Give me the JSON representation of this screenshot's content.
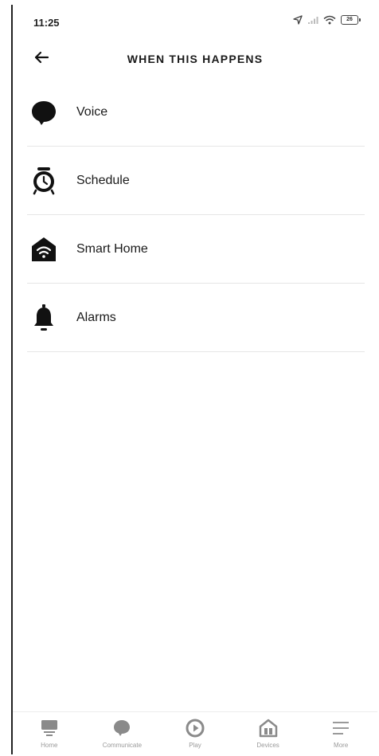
{
  "status_bar": {
    "time": "11:25",
    "battery": "26",
    "icons": [
      "location-arrow-icon",
      "signal-icon",
      "wifi-icon",
      "battery-icon"
    ]
  },
  "header": {
    "title": "WHEN THIS HAPPENS",
    "back_icon": "arrow-left-icon"
  },
  "triggers": [
    {
      "label": "Voice",
      "icon": "speech-bubble-icon"
    },
    {
      "label": "Schedule",
      "icon": "alarm-clock-icon"
    },
    {
      "label": "Smart Home",
      "icon": "smart-home-icon"
    },
    {
      "label": "Alarms",
      "icon": "bell-icon"
    }
  ],
  "bottom_nav": [
    {
      "label": "Home",
      "icon": "home-icon"
    },
    {
      "label": "Communicate",
      "icon": "speech-bubble-icon"
    },
    {
      "label": "Play",
      "icon": "play-icon"
    },
    {
      "label": "Devices",
      "icon": "devices-icon"
    },
    {
      "label": "More",
      "icon": "menu-icon"
    }
  ],
  "colors": {
    "text": "#111111",
    "divider": "#e6e6e6",
    "nav_inactive": "#9a9a9a"
  }
}
